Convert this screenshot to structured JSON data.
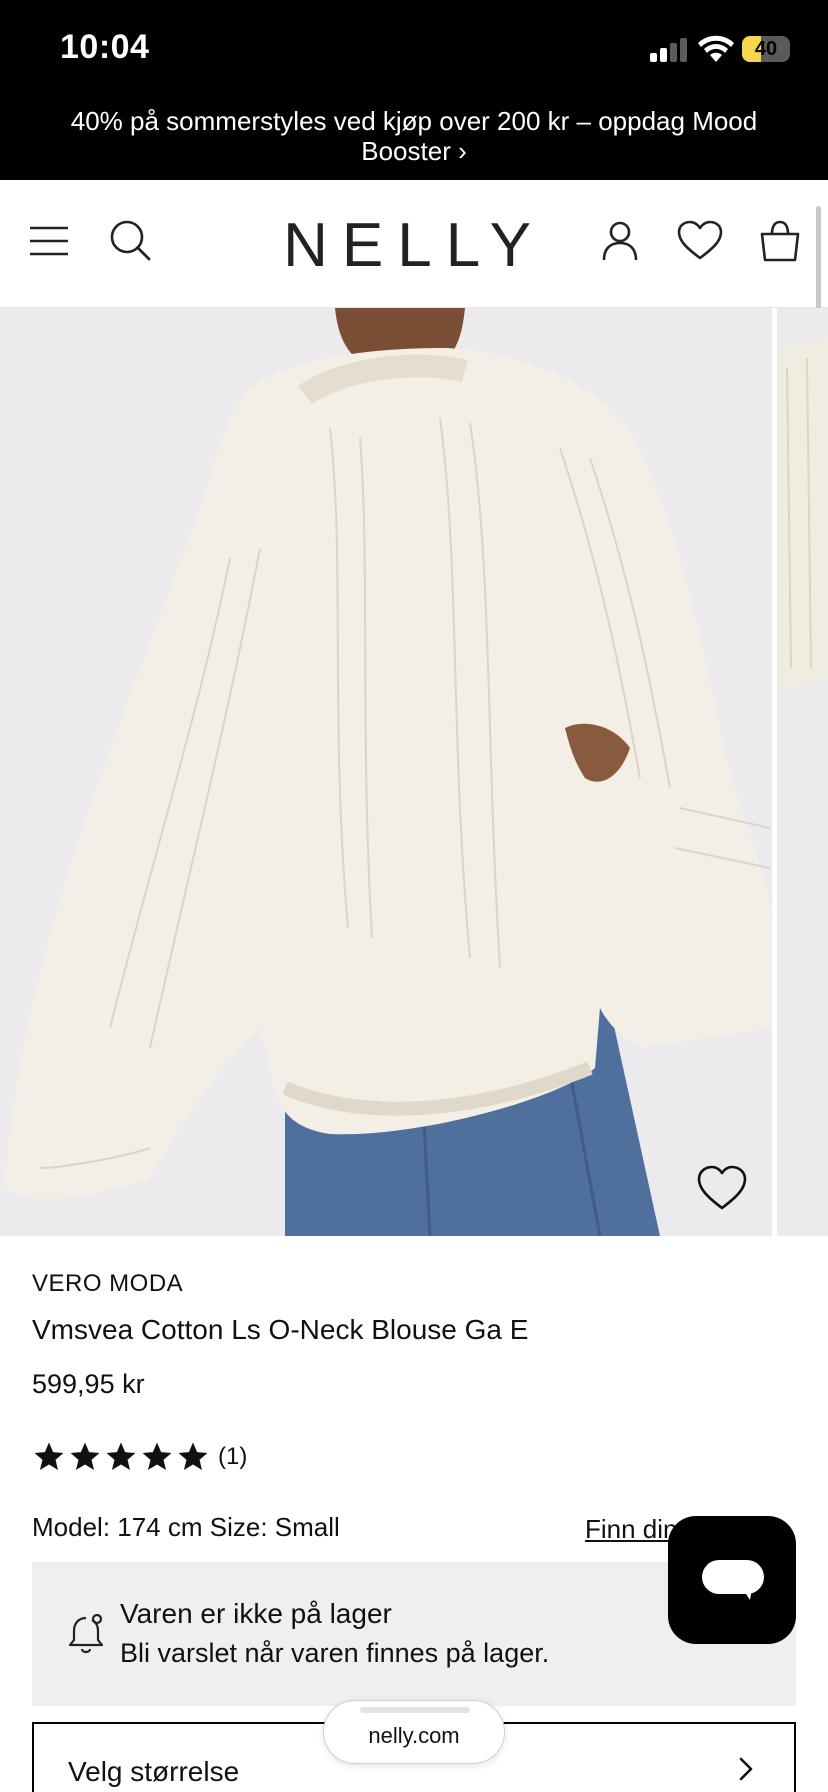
{
  "status_bar": {
    "time": "10:04",
    "battery": "40",
    "battery_level_percent": 40,
    "signal_bars_active": 2
  },
  "promo": {
    "text": "40% på sommerstyles ved kjøp over 200 kr – oppdag Mood Booster  ›"
  },
  "header": {
    "logo": "NELLY",
    "icons": [
      "menu-icon",
      "search-icon",
      "account-icon",
      "wishlist-icon",
      "bag-icon"
    ]
  },
  "product": {
    "brand": "VERO MODA",
    "name": "Vmsvea Cotton Ls O-Neck Blouse Ga E",
    "price": "599,95 kr",
    "rating": {
      "stars": 5,
      "review_count": "(1)"
    },
    "model_info": "Model: 174 cm Size: Small",
    "size_guide_link": "Finn din størrelse"
  },
  "stock_notice": {
    "title": "Varen er ikke på lager",
    "subtitle": "Bli varslet når varen finnes på lager."
  },
  "size_selector": {
    "label": "Velg størrelse"
  },
  "browser": {
    "url": "nelly.com"
  },
  "colors": {
    "banner_bg": "#000000",
    "battery_accent": "#f6d64a",
    "stock_bg": "#efefef",
    "chat_bg": "#000000"
  }
}
